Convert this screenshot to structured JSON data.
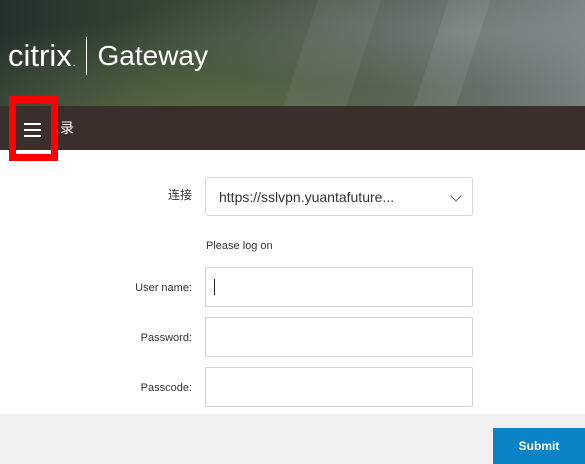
{
  "brand": {
    "company": "citrix",
    "product": "Gateway",
    "trademark": "."
  },
  "nav": {
    "menu_icon": "hamburger-menu-icon",
    "title": "录"
  },
  "form": {
    "connection_label": "连接",
    "connection_value": "https://sslvpn.yuantafuture...",
    "prompt": "Please log on",
    "username_label": "User name:",
    "password_label": "Password:",
    "passcode_label": "Passcode:",
    "username_value": "",
    "password_value": "",
    "passcode_value": "",
    "submit_label": "Submit"
  },
  "colors": {
    "navbar": "#3a2f2b",
    "submit": "#0a84c6",
    "highlight": "#ff0000",
    "footer": "#f1f1f1"
  }
}
